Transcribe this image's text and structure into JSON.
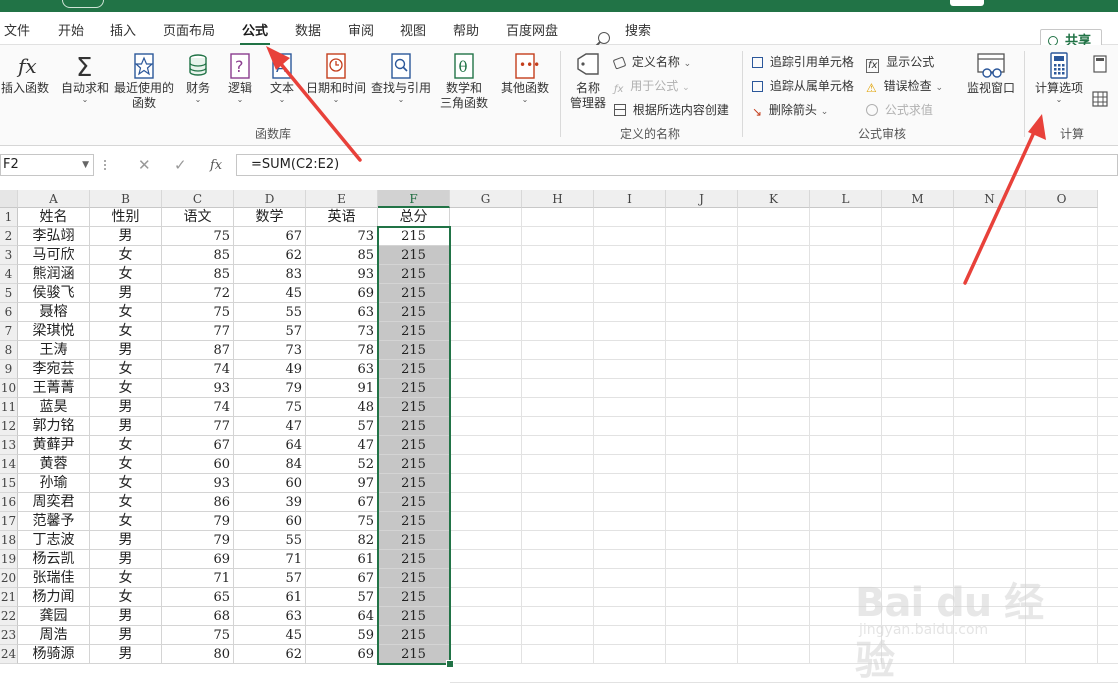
{
  "tabs": [
    "文件",
    "开始",
    "插入",
    "页面布局",
    "公式",
    "数据",
    "审阅",
    "视图",
    "帮助",
    "百度网盘"
  ],
  "active_tab": "公式",
  "search_label": "搜索",
  "share_label": "共享",
  "ribbon": {
    "function_library": {
      "insert_function": "插入函数",
      "autosum": "自动求和",
      "recent_line1": "最近使用的",
      "recent_line2": "函数",
      "financial": "财务",
      "logical": "逻辑",
      "text": "文本",
      "datetime": "日期和时间",
      "lookup": "查找与引用",
      "math_line1": "数学和",
      "math_line2": "三角函数",
      "more": "其他函数",
      "group_label": "函数库"
    },
    "defined_names": {
      "name_manager_line1": "名称",
      "name_manager_line2": "管理器",
      "define_name": "定义名称",
      "use_in_formula": "用于公式",
      "create_from_selection": "根据所选内容创建",
      "group_label": "定义的名称"
    },
    "formula_auditing": {
      "trace_precedents": "追踪引用单元格",
      "trace_dependents": "追踪从属单元格",
      "remove_arrows": "删除箭头",
      "show_formulas": "显示公式",
      "error_checking": "错误检查",
      "evaluate_formula": "公式求值",
      "watch_window": "监视窗口",
      "group_label": "公式审核"
    },
    "calculation": {
      "calc_options": "计算选项",
      "group_label": "计算"
    }
  },
  "formula_bar": {
    "name_box": "F2",
    "formula": "=SUM(C2:E2)"
  },
  "columns": [
    "A",
    "B",
    "C",
    "D",
    "E",
    "F",
    "G",
    "H",
    "I",
    "J",
    "K",
    "L",
    "M",
    "N",
    "O"
  ],
  "selected_column": "F",
  "headers": [
    "姓名",
    "性别",
    "语文",
    "数学",
    "英语",
    "总分"
  ],
  "rows": [
    [
      "李弘翊",
      "男",
      "75",
      "67",
      "73",
      "215"
    ],
    [
      "马可欣",
      "女",
      "85",
      "62",
      "85",
      "215"
    ],
    [
      "熊润涵",
      "女",
      "85",
      "83",
      "93",
      "215"
    ],
    [
      "侯骏飞",
      "男",
      "72",
      "45",
      "69",
      "215"
    ],
    [
      "聂榕",
      "女",
      "75",
      "55",
      "63",
      "215"
    ],
    [
      "梁琪悦",
      "女",
      "77",
      "57",
      "73",
      "215"
    ],
    [
      "王涛",
      "男",
      "87",
      "73",
      "78",
      "215"
    ],
    [
      "李宛芸",
      "女",
      "74",
      "49",
      "63",
      "215"
    ],
    [
      "王菁菁",
      "女",
      "93",
      "79",
      "91",
      "215"
    ],
    [
      "蓝昊",
      "男",
      "74",
      "75",
      "48",
      "215"
    ],
    [
      "郭力铭",
      "男",
      "77",
      "47",
      "57",
      "215"
    ],
    [
      "黄藓尹",
      "女",
      "67",
      "64",
      "47",
      "215"
    ],
    [
      "黄蓉",
      "女",
      "60",
      "84",
      "52",
      "215"
    ],
    [
      "孙瑜",
      "女",
      "93",
      "60",
      "97",
      "215"
    ],
    [
      "周奕君",
      "女",
      "86",
      "39",
      "67",
      "215"
    ],
    [
      "范馨予",
      "女",
      "79",
      "60",
      "75",
      "215"
    ],
    [
      "丁志波",
      "男",
      "79",
      "55",
      "82",
      "215"
    ],
    [
      "杨云凯",
      "男",
      "69",
      "71",
      "61",
      "215"
    ],
    [
      "张瑞佳",
      "女",
      "71",
      "57",
      "67",
      "215"
    ],
    [
      "杨力闻",
      "女",
      "65",
      "61",
      "57",
      "215"
    ],
    [
      "龚园",
      "男",
      "68",
      "63",
      "64",
      "215"
    ],
    [
      "周浩",
      "男",
      "75",
      "45",
      "59",
      "215"
    ],
    [
      "杨骑源",
      "男",
      "80",
      "62",
      "69",
      "215"
    ]
  ],
  "row_numbers": [
    "1",
    "2",
    "3",
    "4",
    "5",
    "6",
    "7",
    "8",
    "9",
    "10",
    "11",
    "12",
    "13",
    "14",
    "15",
    "16",
    "17",
    "18",
    "19",
    "20",
    "21",
    "22",
    "23",
    "24"
  ],
  "watermark": {
    "brand": "Bai du 经验",
    "sub": "jingyan.baidu.com"
  },
  "colors": {
    "excel_green": "#217346",
    "annotation_red": "#e8413a",
    "selected_fill": "#c6c6c6"
  }
}
